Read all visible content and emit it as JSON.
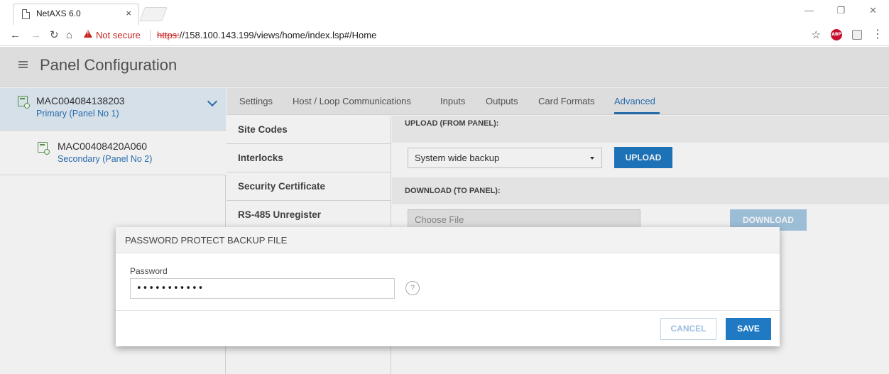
{
  "browser": {
    "tab_title": "NetAXS 6.0",
    "tab_close": "×",
    "security_label": "Not secure",
    "url_scheme": "https:",
    "url_rest": "//158.100.143.199/views/home/index.lsp#/Home",
    "abp_label": "ABP"
  },
  "app": {
    "title": "Panel Configuration",
    "panels": [
      {
        "name": "MAC004084138203",
        "sub": "Primary (Panel No 1)"
      },
      {
        "name": "MAC00408420A060",
        "sub": "Secondary (Panel No 2)"
      }
    ],
    "tabs": [
      "Settings",
      "Host / Loop Communications",
      "Inputs",
      "Outputs",
      "Card Formats",
      "Advanced"
    ],
    "active_tab": "Advanced",
    "subnav": [
      "Site Codes",
      "Interlocks",
      "Security Certificate",
      "RS-485 Unregister"
    ],
    "upload": {
      "header": "UPLOAD (FROM PANEL):",
      "select_value": "System wide backup",
      "button": "UPLOAD"
    },
    "download": {
      "header": "DOWNLOAD (TO PANEL):",
      "file_placeholder": "Choose File",
      "button": "DOWNLOAD"
    }
  },
  "modal": {
    "title": "PASSWORD PROTECT BACKUP FILE",
    "password_label": "Password",
    "password_value": "•••••••••••",
    "help_glyph": "?",
    "cancel_label": "CANCEL",
    "save_label": "SAVE"
  },
  "colors": {
    "accent": "#1f7ac3",
    "primary_panel_bg": "#e3eef8",
    "warning": "#c5221f"
  }
}
